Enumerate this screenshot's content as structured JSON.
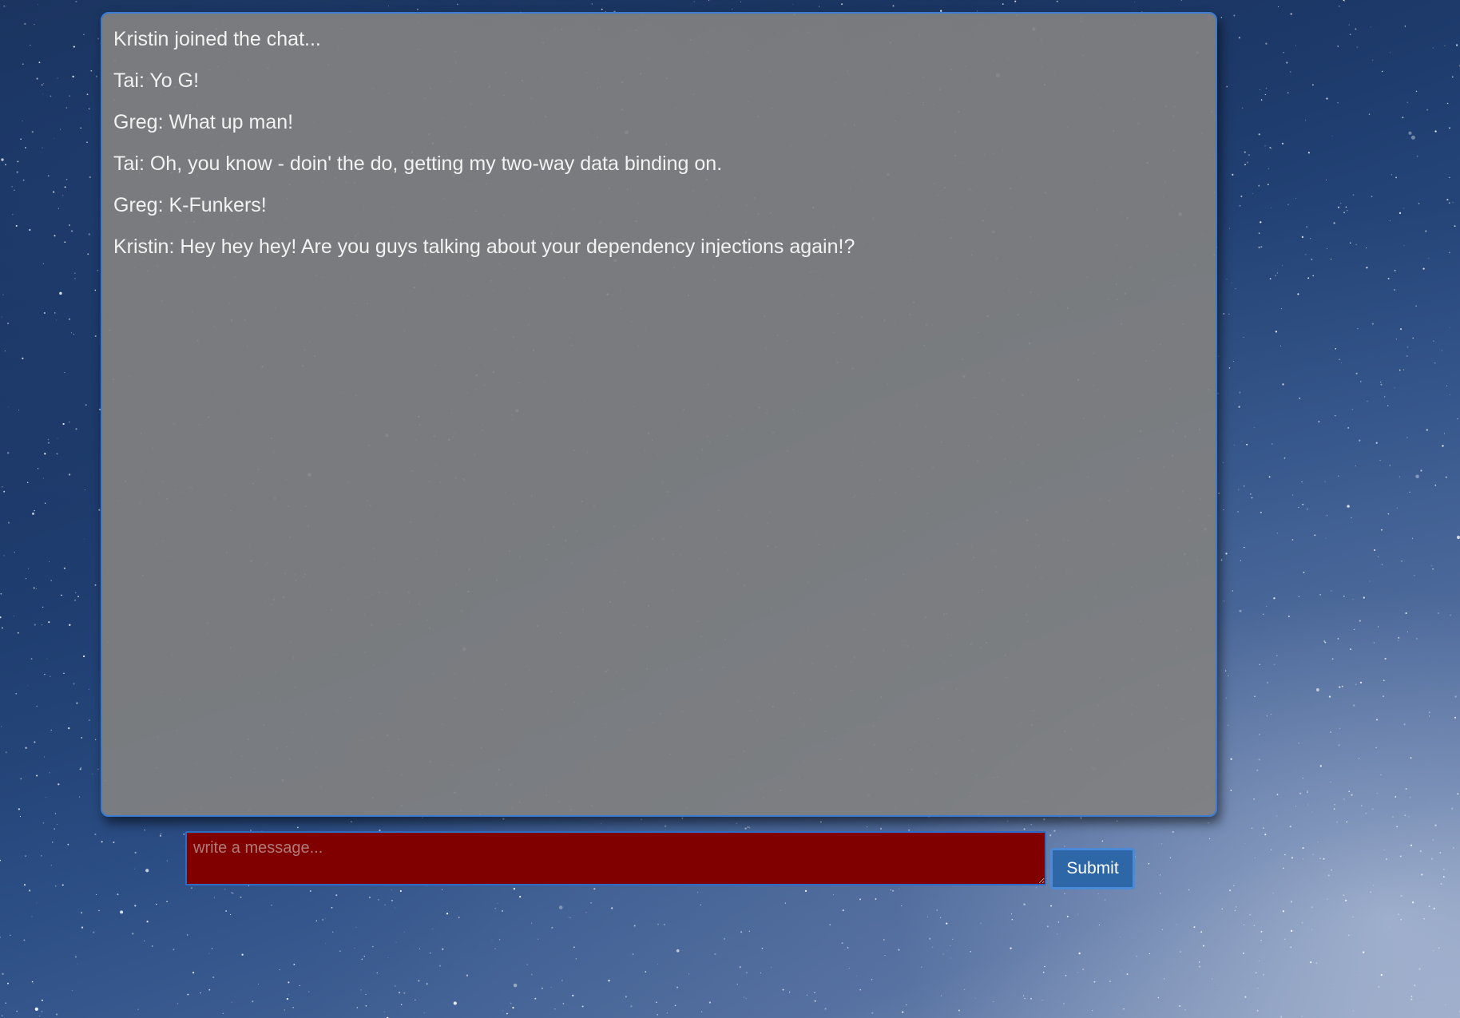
{
  "chat": {
    "messages": [
      "Kristin joined the chat...",
      "Tai: Yo G!",
      "Greg: What up man!",
      "Tai: Oh, you know - doin' the do, getting my two-way data binding on.",
      "Greg: K-Funkers!",
      "Kristin: Hey hey hey! Are you guys talking about your dependency injections again!?"
    ]
  },
  "composer": {
    "input_value": "",
    "placeholder": "write a message...",
    "submit_label": "Submit"
  },
  "colors": {
    "chat_background": "#808080",
    "chat_border": "#3b7bd1",
    "input_background": "#800000",
    "submit_background": "#2d67a8"
  }
}
